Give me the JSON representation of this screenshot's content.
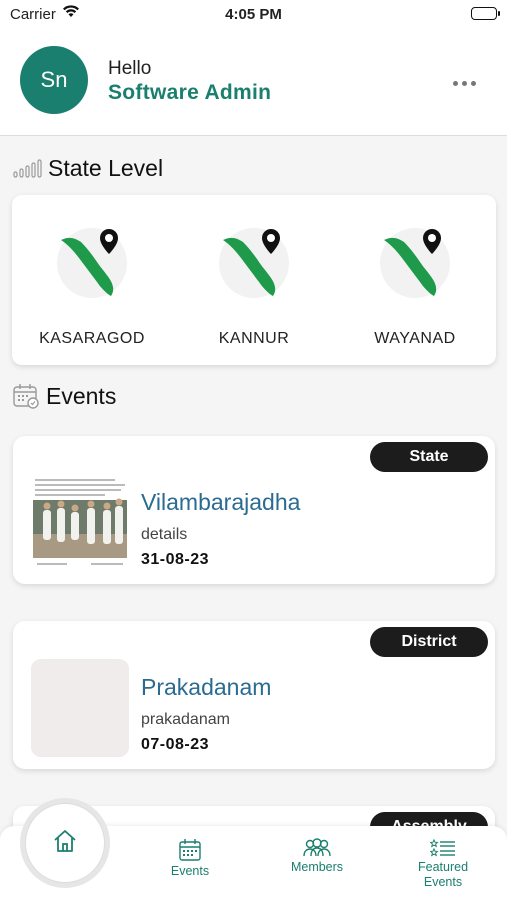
{
  "status_bar": {
    "carrier": "Carrier",
    "time": "4:05 PM"
  },
  "header": {
    "avatar_initials": "Sn",
    "greeting": "Hello",
    "user_name": "Software Admin"
  },
  "state_level": {
    "title": "State Level",
    "districts": [
      {
        "name": "KASARAGOD"
      },
      {
        "name": "KANNUR"
      },
      {
        "name": "WAYANAD"
      }
    ]
  },
  "events": {
    "title": "Events",
    "items": [
      {
        "badge": "State",
        "title": "Vilambarajadha",
        "details": "details",
        "date": "31-08-23"
      },
      {
        "badge": "District",
        "title": "Prakadanam",
        "details": "prakadanam",
        "date": "07-08-23"
      },
      {
        "badge": "Assembly"
      }
    ]
  },
  "bottom_nav": {
    "items": [
      {
        "label": "Events"
      },
      {
        "label": "Members"
      },
      {
        "label": "Featured Events"
      }
    ]
  },
  "colors": {
    "accent": "#1a7f6e",
    "title_blue": "#2a6b92",
    "badge_bg": "#1c1c1c"
  }
}
